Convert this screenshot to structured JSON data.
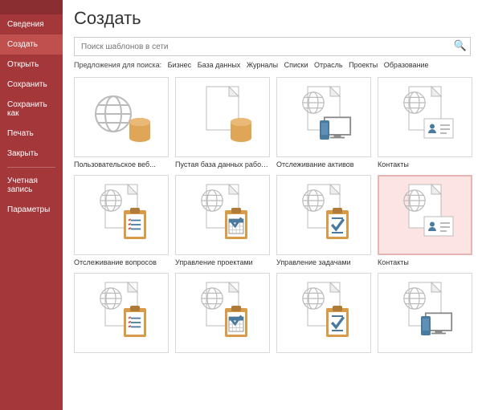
{
  "sidebar": {
    "items": [
      {
        "label": "Сведения"
      },
      {
        "label": "Создать"
      },
      {
        "label": "Открыть"
      },
      {
        "label": "Сохранить"
      },
      {
        "label": "Сохранить как"
      },
      {
        "label": "Печать"
      },
      {
        "label": "Закрыть"
      }
    ],
    "account_label": "Учетная\nзапись",
    "options_label": "Параметры"
  },
  "page": {
    "title": "Создать"
  },
  "search": {
    "placeholder": "Поиск шаблонов в сети"
  },
  "suggestions": {
    "prefix": "Предложения для поиска:",
    "items": [
      "Бизнес",
      "База данных",
      "Журналы",
      "Списки",
      "Отрасль",
      "Проекты",
      "Образование"
    ]
  },
  "templates": [
    {
      "label": "Пользовательское веб...",
      "icon": "globe-db"
    },
    {
      "label": "Пустая база данных рабочего...",
      "icon": "blank-db"
    },
    {
      "label": "Отслеживание активов",
      "icon": "assets"
    },
    {
      "label": "Контакты",
      "icon": "contacts"
    },
    {
      "label": "Отслеживание вопросов",
      "icon": "issues"
    },
    {
      "label": "Управление проектами",
      "icon": "projects"
    },
    {
      "label": "Управление задачами",
      "icon": "tasks"
    },
    {
      "label": "Контакты",
      "icon": "contacts",
      "selected": true
    },
    {
      "label": "",
      "icon": "issues"
    },
    {
      "label": "",
      "icon": "projects"
    },
    {
      "label": "",
      "icon": "tasks"
    },
    {
      "label": "",
      "icon": "assets"
    }
  ]
}
